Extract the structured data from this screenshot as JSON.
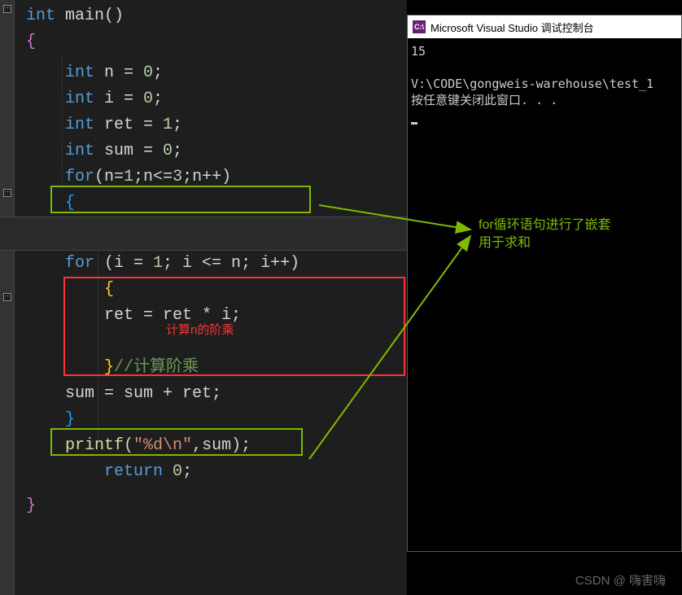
{
  "editor": {
    "lines": {
      "l1a": "int",
      "l1b": " main()",
      "l2": "{",
      "l3a": "    int",
      "l3b": " n = ",
      "l3c": "0",
      "l3d": ";",
      "l4a": "    int",
      "l4b": " i = ",
      "l4c": "0",
      "l4d": ";",
      "l5a": "    int",
      "l5b": " ret = ",
      "l5c": "1",
      "l5d": ";",
      "l6a": "    int",
      "l6b": " sum = ",
      "l6c": "0",
      "l6d": ";",
      "l7a": "    for",
      "l7b": "(n=",
      "l7c": "1",
      "l7d": ";n<=",
      "l7e": "3",
      "l7f": ";n++)",
      "l8": "    {",
      "l10a": "    for",
      "l10b": " (i = ",
      "l10c": "1",
      "l10d": "; i <= n; i++)",
      "l11": "        {",
      "l12a": "        ret = ret * i;",
      "l14a": "        }",
      "l14b": "//计算阶乘",
      "l15": "    sum = sum + ret;",
      "l16": "    }",
      "l17a": "    printf",
      "l17b": "(",
      "l17c": "\"%d\\n\"",
      "l17d": ",sum);",
      "l18a": "        return",
      "l18b": " ",
      "l18c": "0",
      "l18d": ";",
      "l19": "}"
    },
    "annotation_inner": "计算n的阶乘"
  },
  "console": {
    "title": "Microsoft Visual Studio 调试控制台",
    "output_line1": "15",
    "output_line2": "V:\\CODE\\gongweis-warehouse\\test_1",
    "output_line3": "按任意键关闭此窗口. . ."
  },
  "annotations": {
    "green_line1": "for循环语句进行了嵌套",
    "green_line2": "用于求和"
  },
  "watermark": "CSDN @    嗨害嗨"
}
